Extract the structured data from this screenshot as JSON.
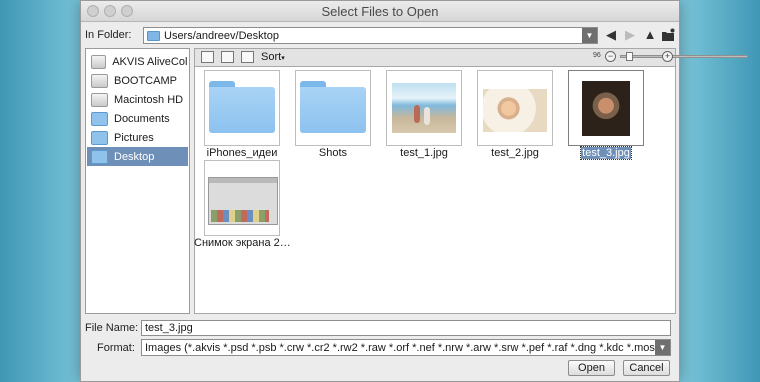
{
  "window": {
    "title": "Select Files to Open"
  },
  "location": {
    "label": "In Folder:",
    "path": "Users/andreev/Desktop"
  },
  "sidebar": {
    "items": [
      {
        "label": "AKVIS AliveCol…",
        "icon": "drive-icon"
      },
      {
        "label": "BOOTCAMP",
        "icon": "drive-icon"
      },
      {
        "label": "Macintosh HD",
        "icon": "drive-icon"
      },
      {
        "label": "Documents",
        "icon": "folder-icon"
      },
      {
        "label": "Pictures",
        "icon": "folder-icon"
      },
      {
        "label": "Desktop",
        "icon": "folder-icon",
        "selected": true
      }
    ]
  },
  "toolbar": {
    "sort_label": "Sort",
    "zoom_value": "96",
    "zoom_level": 0.05
  },
  "files": [
    {
      "name": "iPhones_идеи",
      "kind": "folder"
    },
    {
      "name": "Shots",
      "kind": "folder"
    },
    {
      "name": "test_1.jpg",
      "kind": "image"
    },
    {
      "name": "test_2.jpg",
      "kind": "image"
    },
    {
      "name": "test_3.jpg",
      "kind": "image",
      "selected": true
    },
    {
      "name": "Снимок экрана 2…",
      "kind": "image"
    }
  ],
  "file_name": {
    "label": "File Name:",
    "value": "test_3.jpg"
  },
  "format": {
    "label": "Format:",
    "value": "Images (*.akvis *.psd *.psb *.crw *.cr2 *.rw2 *.raw *.orf *.nef *.nrw *.arw *.srw *.pef *.raf *.dng *.kdc *.mos *.png *.bmp *.jpg"
  },
  "buttons": {
    "open": "Open",
    "cancel": "Cancel"
  },
  "colors": {
    "selection": "#6e8fb8",
    "folder": "#8cc2ef"
  }
}
